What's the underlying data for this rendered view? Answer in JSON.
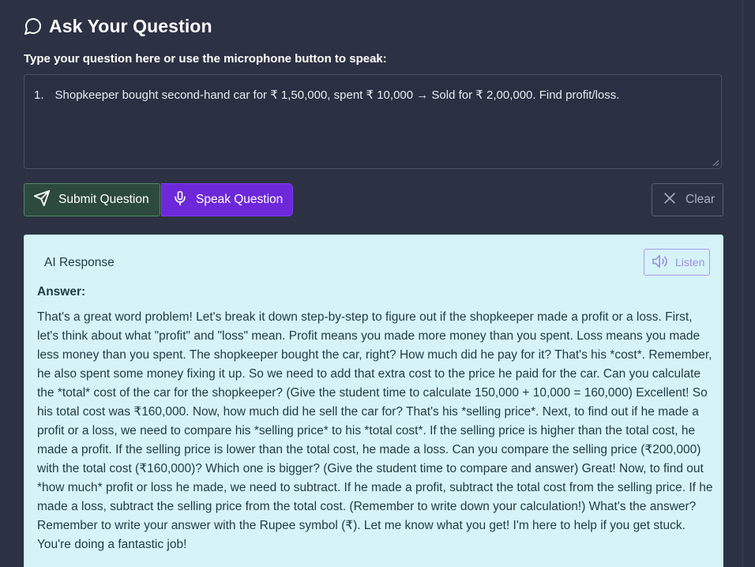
{
  "header": {
    "title": "Ask Your Question",
    "icon": "chat-bubble-icon"
  },
  "form": {
    "instruction": "Type your question here or use the microphone button to speak:",
    "question_number": "1.",
    "question_text": "Shopkeeper bought second-hand car for ₹ 1,50,000, spent ₹ 10,000 → Sold for ₹ 2,00,000. Find profit/loss."
  },
  "buttons": {
    "submit_label": "Submit Question",
    "submit_icon": "send-icon",
    "speak_label": "Speak Question",
    "speak_icon": "microphone-icon",
    "clear_label": "Clear",
    "clear_icon": "close-icon"
  },
  "response": {
    "title": "AI Response",
    "listen_label": "Listen",
    "listen_icon": "speaker-icon",
    "answer_label": "Answer:",
    "answer_text": "That's a great word problem! Let's break it down step-by-step to figure out if the shopkeeper made a profit or a loss. First, let's think about what \"profit\" and \"loss\" mean. Profit means you made more money than you spent. Loss means you made less money than you spent. The shopkeeper bought the car, right? How much did he pay for it? That's his *cost*. Remember, he also spent some money fixing it up. So we need to add that extra cost to the price he paid for the car. Can you calculate the *total* cost of the car for the shopkeeper? (Give the student time to calculate 150,000 + 10,000 = 160,000) Excellent! So his total cost was ₹160,000. Now, how much did he sell the car for? That's his *selling price*. Next, to find out if he made a profit or a loss, we need to compare his *selling price* to his *total cost*. If the selling price is higher than the total cost, he made a profit. If the selling price is lower than the total cost, he made a loss. Can you compare the selling price (₹200,000) with the total cost (₹160,000)? Which one is bigger? (Give the student time to compare and answer) Great! Now, to find out *how much* profit or loss he made, we need to subtract. If he made a profit, subtract the total cost from the selling price. If he made a loss, subtract the selling price from the total cost. (Remember to write down your calculation!) What's the answer? Remember to write your answer with the Rupee symbol (₹). Let me know what you get! I'm here to help if you get stuck. You're doing a fantastic job!"
  },
  "colors": {
    "background": "#2c3243",
    "submit_bg": "#2d4a3e",
    "speak_bg": "#6d28d9",
    "response_bg": "#d6f3f7",
    "listen_accent": "#9d90e0"
  }
}
